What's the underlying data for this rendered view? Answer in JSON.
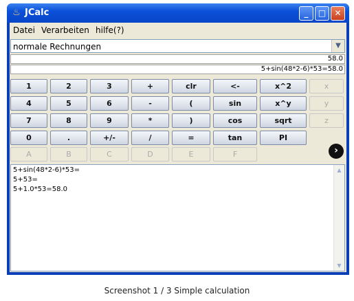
{
  "window": {
    "title": "JCalc",
    "app_icon": "java-cup-icon",
    "controls": {
      "minimize": "_",
      "maximize": "□",
      "close": "✕"
    }
  },
  "menubar": {
    "items": [
      "Datei",
      "Verarbeiten",
      "hilfe(?)"
    ]
  },
  "mode_select": {
    "selected": "normale Rechnungen"
  },
  "display": {
    "result": "58.0",
    "expression": "5+sin(48*2-6)*53=58.0"
  },
  "keypad": {
    "rows": [
      [
        "1",
        "2",
        "3",
        "+",
        "clr",
        "<-",
        "x^2",
        "x"
      ],
      [
        "4",
        "5",
        "6",
        "-",
        "(",
        "sin",
        "x^y",
        "y"
      ],
      [
        "7",
        "8",
        "9",
        "*",
        ")",
        "cos",
        "sqrt",
        "z"
      ],
      [
        "0",
        ".",
        "+/-",
        "/",
        "=",
        "tan",
        "PI"
      ],
      [
        "A",
        "B",
        "C",
        "D",
        "E",
        "F"
      ]
    ]
  },
  "go_button": {
    "label": "›",
    "icon": "arrow-right-circle-icon"
  },
  "log": {
    "lines": [
      "5+sin(48*2-6)*53=",
      "5+53=",
      "5+1.0*53=58.0"
    ]
  },
  "caption": "Screenshot 1 / 3   Simple calculation"
}
